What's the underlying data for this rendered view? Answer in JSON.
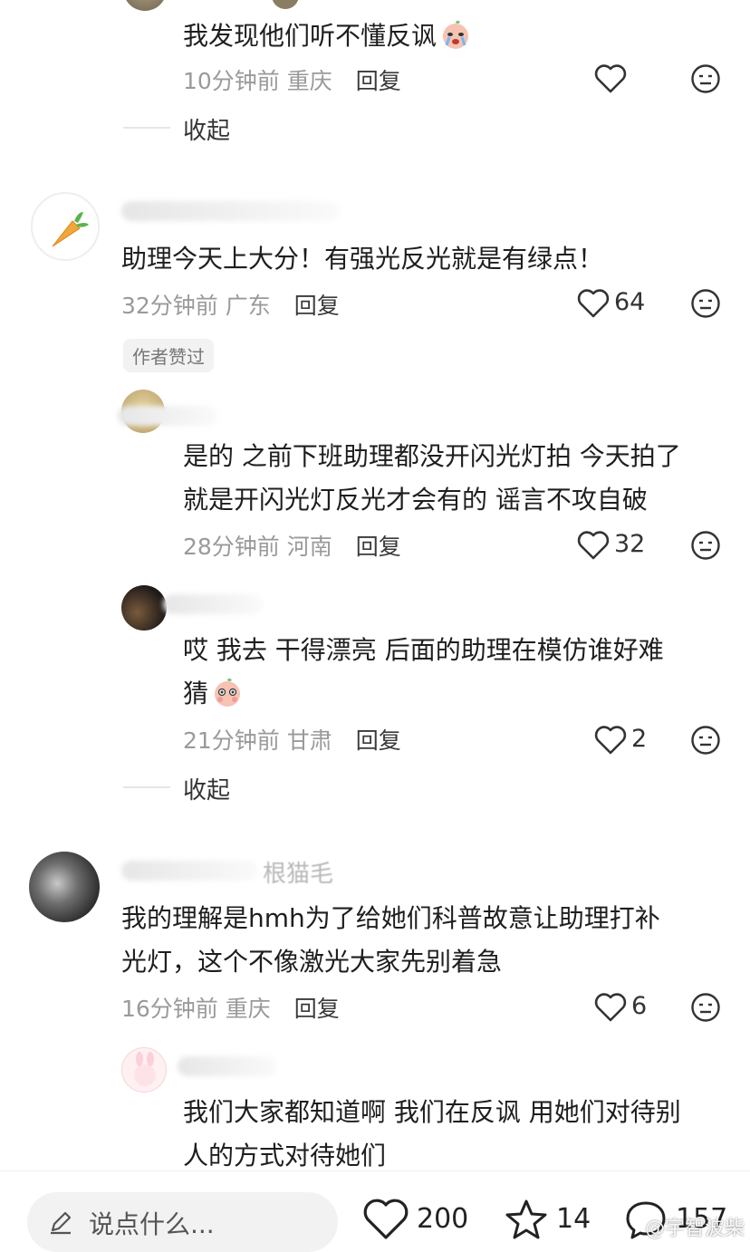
{
  "comments": [
    {
      "text_lines": [
        "我发现他们听不懂反讽"
      ],
      "time": "10分钟前",
      "location": "重庆",
      "reply_label": "回复",
      "likes": "",
      "collapse_label": "收起"
    },
    {
      "text_lines": [
        "助理今天上大分！有强光反光就是有绿点！"
      ],
      "time": "32分钟前",
      "location": "广东",
      "reply_label": "回复",
      "likes": "64",
      "author_liked_label": "作者赞过"
    },
    {
      "text_lines": [
        "是的 之前下班助理都没开闪光灯拍 今天拍了",
        "就是开闪光灯反光才会有的 谣言不攻自破"
      ],
      "time": "28分钟前",
      "location": "河南",
      "reply_label": "回复",
      "likes": "32"
    },
    {
      "text_lines": [
        "哎 我去 干得漂亮 后面的助理在模仿谁好难",
        "猜"
      ],
      "time": "21分钟前",
      "location": "甘肃",
      "reply_label": "回复",
      "likes": "2",
      "collapse_label": "收起"
    },
    {
      "username_partial": "根猫毛",
      "text_lines": [
        "我的理解是hmh为了给她们科普故意让助理打补",
        "光灯，这个不像激光大家先别着急"
      ],
      "time": "16分钟前",
      "location": "重庆",
      "reply_label": "回复",
      "likes": "6"
    },
    {
      "text_lines": [
        "我们大家都知道啊 我们在反讽 用她们对待别",
        "人的方式对待她们"
      ]
    }
  ],
  "bottom_bar": {
    "input_placeholder": "说点什么...",
    "likes": "200",
    "favorites": "14",
    "comments": "157"
  },
  "watermark": "@宇智波柴",
  "colors": {
    "meta_gray": "#9a9a9a",
    "text": "#1e1e1e"
  }
}
